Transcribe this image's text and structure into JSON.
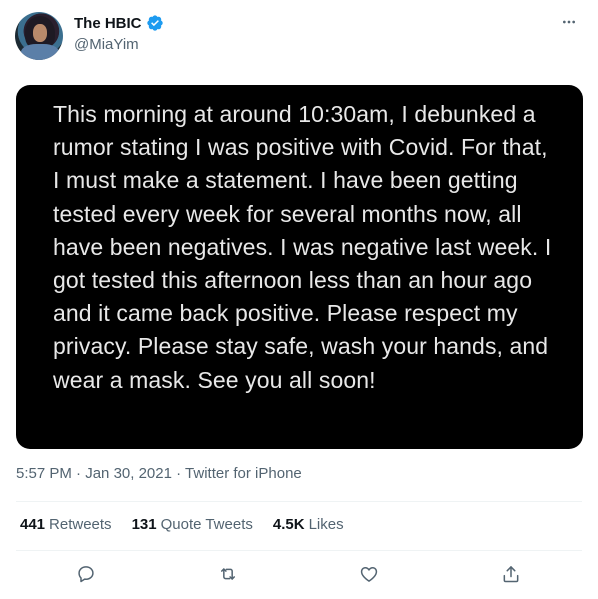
{
  "author": {
    "display_name": "The HBIC",
    "handle": "@MiaYim",
    "verified": true,
    "verified_color": "#1d9bf0"
  },
  "media": {
    "text": "This morning at around 10:30am, I debunked a rumor stating I was positive with Covid. For that, I must make a statement. I have been getting tested every week for several months now, all have been negatives. I was negative last week. I got tested this afternoon less than an hour ago and it came back positive. Please respect my privacy. Please stay safe, wash your hands, and wear a mask. See you all soon!"
  },
  "meta": {
    "time": "5:57 PM",
    "date": "Jan 30, 2021",
    "source": "Twitter for iPhone"
  },
  "stats": {
    "retweets_count": "441",
    "retweets_label": "Retweets",
    "quote_count": "131",
    "quote_label": "Quote Tweets",
    "likes_count": "4.5K",
    "likes_label": "Likes"
  },
  "icons": {
    "more": "more-horizontal-icon",
    "reply": "reply-icon",
    "retweet": "retweet-icon",
    "like": "heart-icon",
    "share": "share-icon"
  }
}
